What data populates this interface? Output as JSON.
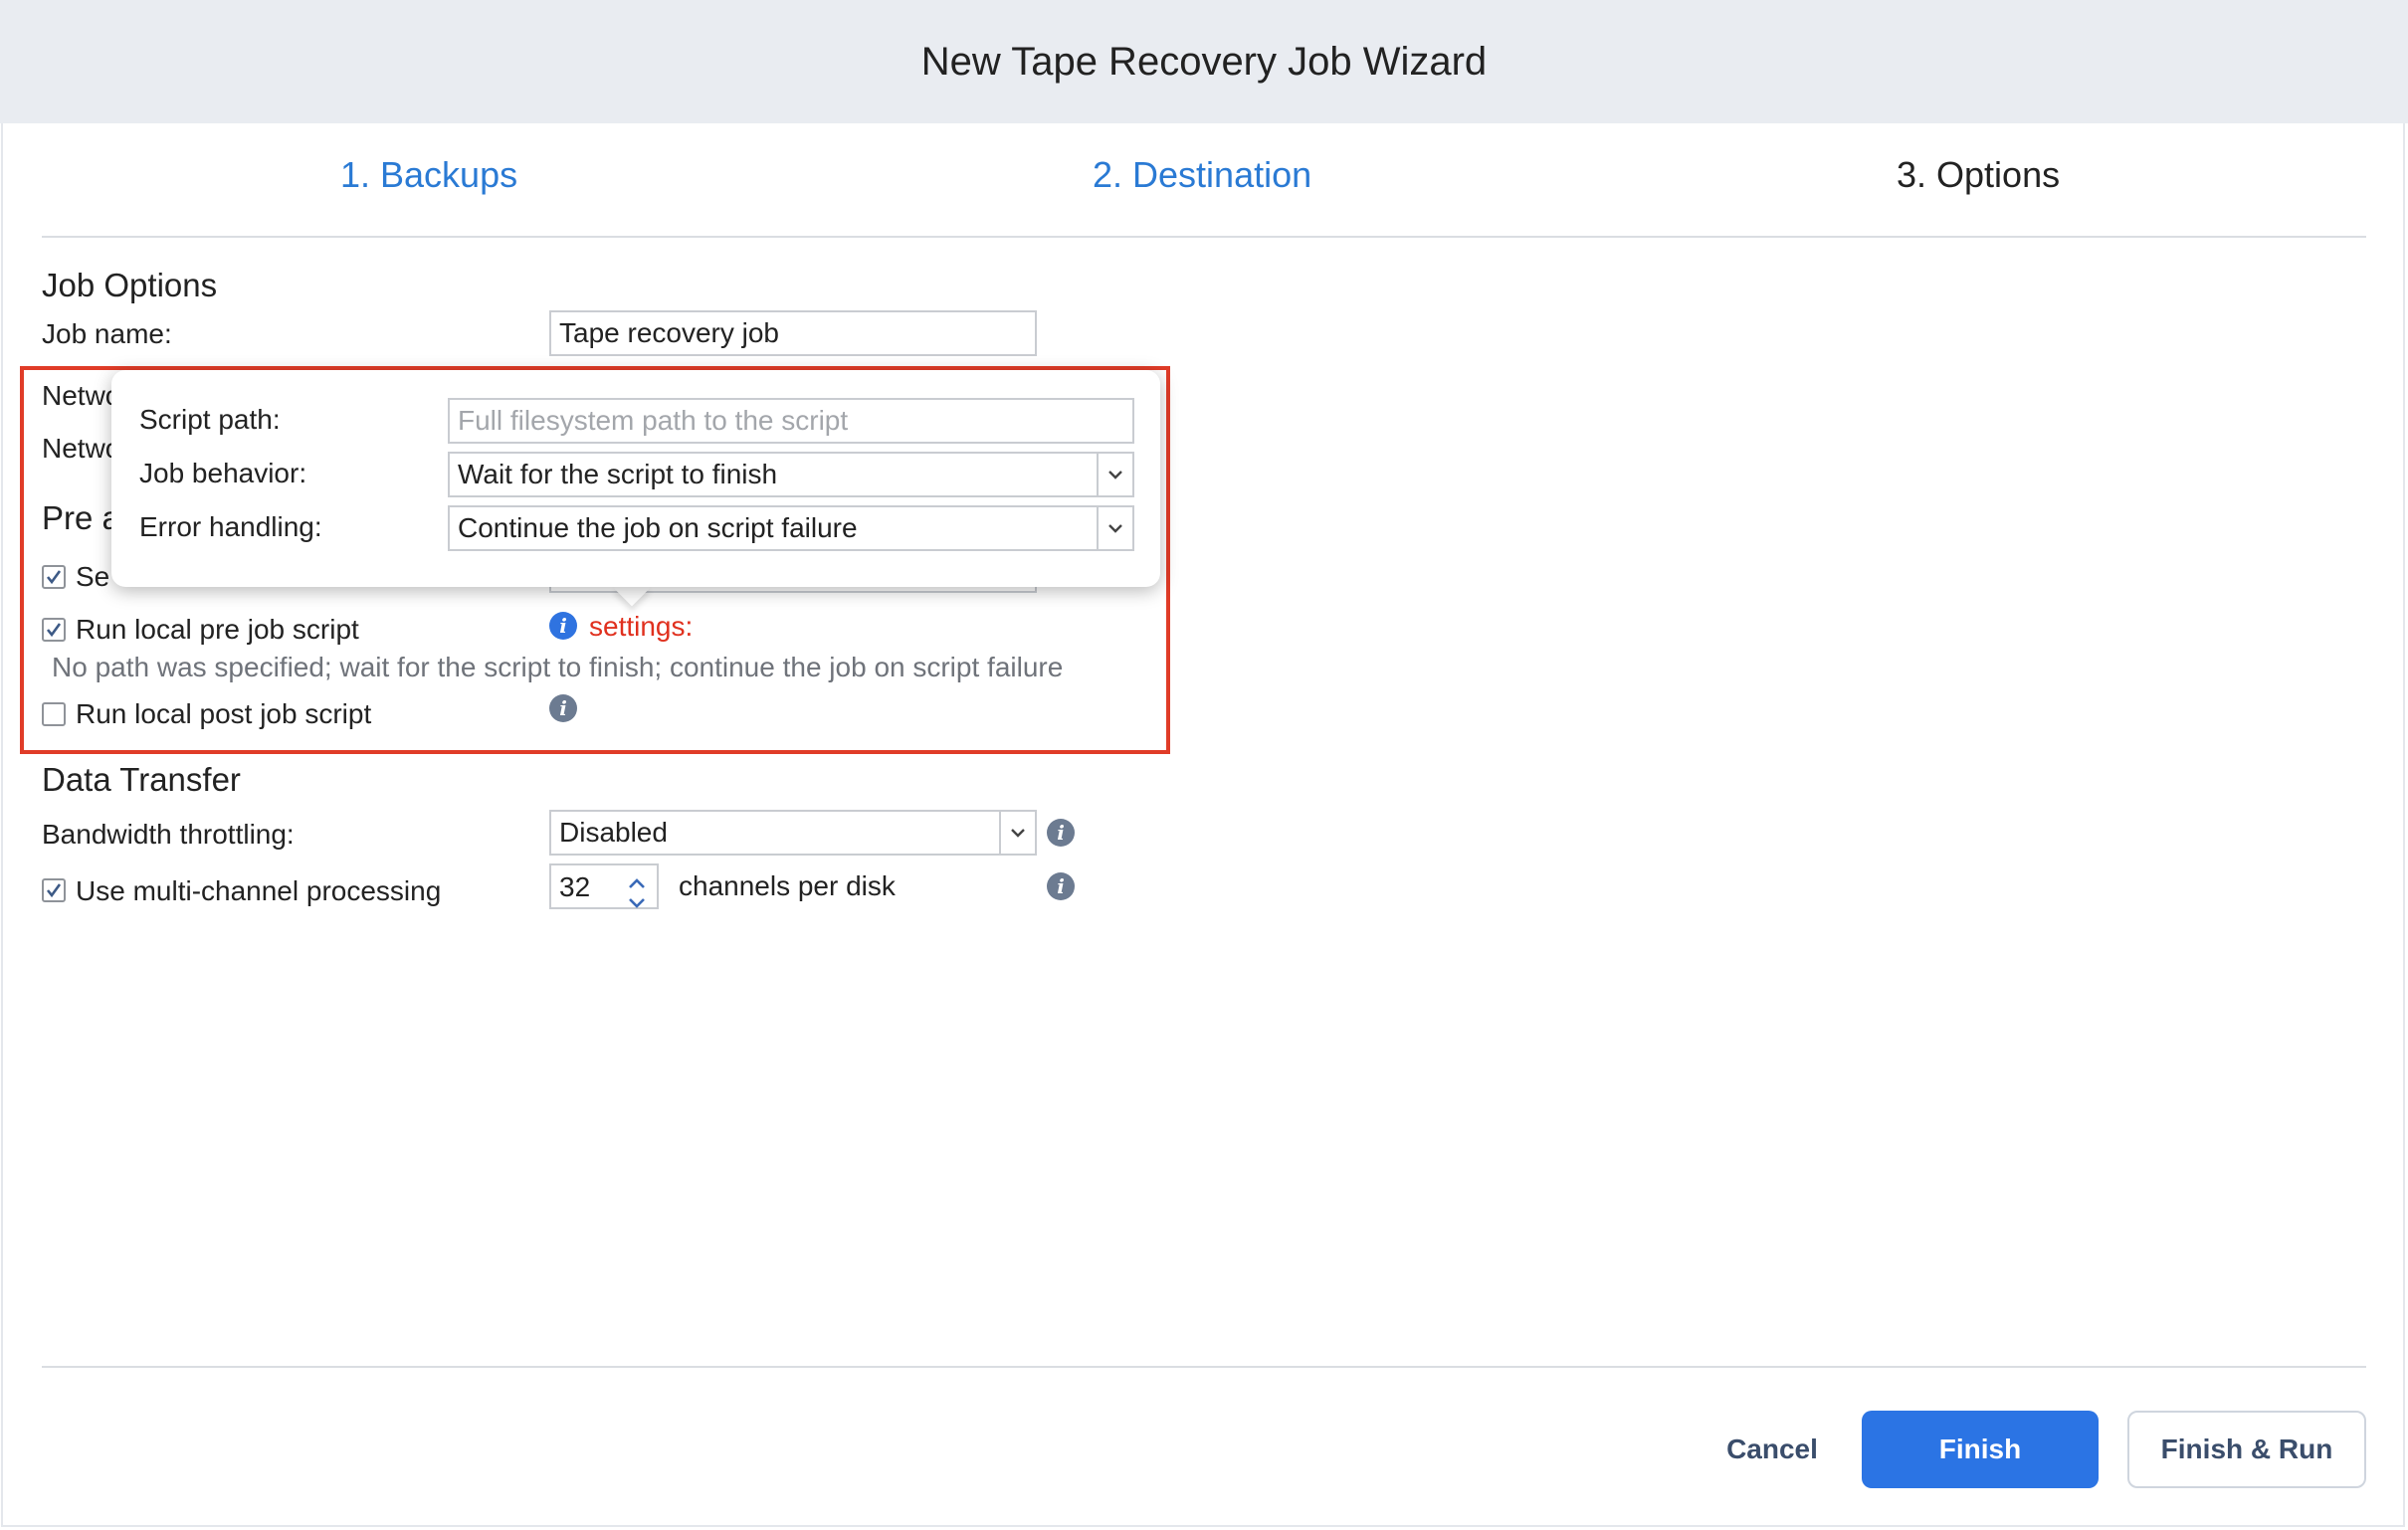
{
  "window": {
    "title": "New Tape Recovery Job Wizard"
  },
  "steps": [
    {
      "label": "1. Backups"
    },
    {
      "label": "2. Destination"
    },
    {
      "label": "3. Options"
    }
  ],
  "job_options": {
    "title": "Job Options",
    "job_name_label": "Job name:",
    "job_name_value": "Tape recovery job",
    "network_label_1": "Netwo",
    "network_label_2": "Netwo",
    "pre_post_title_fragment": "Pre a",
    "send_checkbox_fragment": "Se"
  },
  "script_popup": {
    "script_path_label": "Script path:",
    "script_path_placeholder": "Full filesystem path to the script",
    "job_behavior_label": "Job behavior:",
    "job_behavior_value": "Wait for the script to finish",
    "error_handling_label": "Error handling:",
    "error_handling_value": "Continue the job on script failure"
  },
  "pre_script": {
    "label": "Run local pre job script",
    "checked": true,
    "settings_link": "settings:",
    "summary": "No path was specified; wait for the script to finish; continue the job on script failure"
  },
  "post_script": {
    "label": "Run local post job script",
    "checked": false
  },
  "data_transfer": {
    "title": "Data Transfer",
    "bandwidth_label": "Bandwidth throttling:",
    "bandwidth_value": "Disabled",
    "multichannel_label": "Use multi-channel processing",
    "multichannel_checked": true,
    "channels_value": "32",
    "channels_suffix": "channels per disk"
  },
  "footer": {
    "cancel_label": "Cancel",
    "finish_label": "Finish",
    "finish_run_label": "Finish & Run"
  },
  "colors": {
    "accent": "#2b74e4",
    "step_link": "#2a7ad4",
    "error_red": "#e03c28",
    "header_bg": "#e9ecf1"
  },
  "icons": [
    "info-icon",
    "checkmark-icon",
    "chevron-down-icon",
    "chevron-up-icon"
  ]
}
